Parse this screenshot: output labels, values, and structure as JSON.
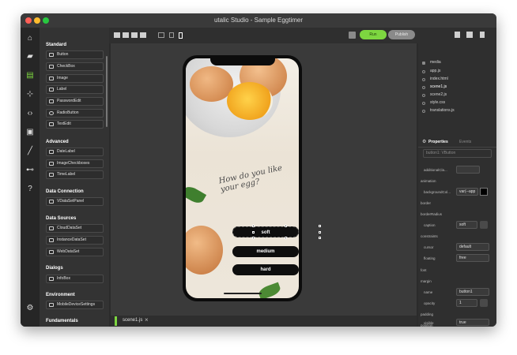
{
  "window": {
    "title": "utalic Studio - Sample Eggtimer"
  },
  "toolbar": {
    "run_label": "Run",
    "publish_label": "Publish"
  },
  "palette": {
    "standard": {
      "title": "Standard",
      "items": [
        "Button",
        "CheckBox",
        "Image",
        "Label",
        "PasswordEdit",
        "RadioButton",
        "TextEdit"
      ]
    },
    "advanced": {
      "title": "Advanced",
      "items": [
        "DateLabel",
        "ImageCheckboxes",
        "TimeLabel"
      ]
    },
    "data_connection": {
      "title": "Data Connection",
      "items": [
        "VDataSetPanel"
      ]
    },
    "data_sources": {
      "title": "Data Sources",
      "items": [
        "CloudDataSet",
        "InstanceDataSet",
        "WebDataSet"
      ]
    },
    "dialogs": {
      "title": "Dialogs",
      "items": [
        "InfoBox"
      ]
    },
    "environment": {
      "title": "Environment",
      "items": [
        "MobileDeviceSettings"
      ]
    },
    "fundamentals": {
      "title": "Fundamentals"
    }
  },
  "phone": {
    "headline": "How do you like your egg?",
    "buttons": [
      "soft",
      "medium",
      "hard"
    ]
  },
  "tab": {
    "label": "scene1.js"
  },
  "files": [
    "media",
    "app.js",
    "index.html",
    "scene1.js",
    "scene2.js",
    "style.css",
    "translations.js"
  ],
  "inspector": {
    "tabs": [
      "Properties",
      "Events"
    ],
    "selected": "button1: VButton",
    "props": {
      "additionalClass": "additionalCla...",
      "animation": "animation",
      "backgroundColor_label": "backgroundCol...",
      "backgroundColor_value": "var(--app",
      "border": "border",
      "borderRadius": "borderRadius",
      "caption_label": "caption",
      "caption_value": "soft",
      "constraints": "constraints",
      "cursor_label": "cursor",
      "cursor_value": "default",
      "floating_label": "floating",
      "floating_value": "free",
      "font": "font",
      "margin": "margin",
      "name_label": "name",
      "name_value": "button1",
      "opacity_label": "opacity",
      "opacity_value": "1",
      "padding": "padding",
      "position": "position",
      "visible_label": "visible",
      "visible_value": "true"
    }
  },
  "colors": {
    "accent": "#7dd640",
    "panel": "#333333",
    "canvas": "#3a3a3a"
  }
}
